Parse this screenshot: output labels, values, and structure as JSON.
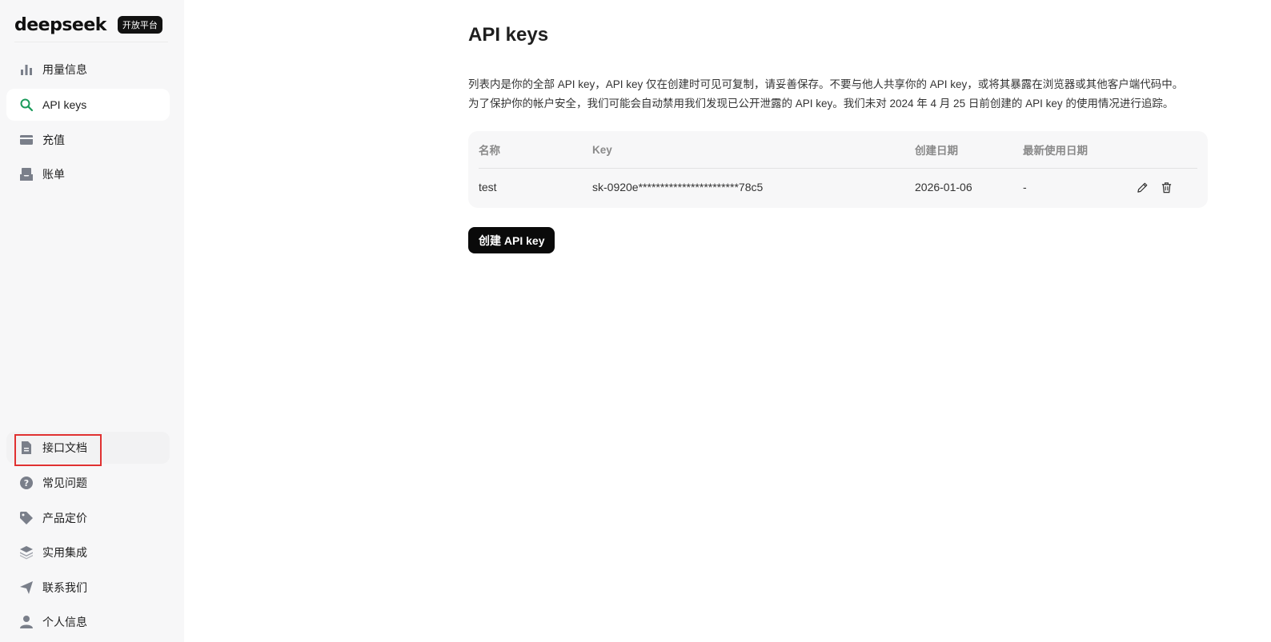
{
  "brand": {
    "logo": "deepseek",
    "badge": "开放平台"
  },
  "sidebar": {
    "top_items": [
      {
        "label": "用量信息",
        "icon": "bar-chart-icon"
      },
      {
        "label": "API keys",
        "icon": "search-icon",
        "active": true
      },
      {
        "label": "充值",
        "icon": "card-icon"
      },
      {
        "label": "账单",
        "icon": "inbox-icon"
      }
    ],
    "bottom_items": [
      {
        "label": "接口文档",
        "icon": "document-icon"
      },
      {
        "label": "常见问题",
        "icon": "question-icon"
      },
      {
        "label": "产品定价",
        "icon": "tag-icon"
      },
      {
        "label": "实用集成",
        "icon": "layers-icon"
      },
      {
        "label": "联系我们",
        "icon": "send-icon"
      },
      {
        "label": "个人信息",
        "icon": "user-icon"
      }
    ]
  },
  "main": {
    "title": "API keys",
    "description_lines": [
      "列表内是你的全部 API key，API key 仅在创建时可见可复制，请妥善保存。不要与他人共享你的 API key，或将其暴露在浏览器或其他客户端代码中。",
      "为了保护你的帐户安全，我们可能会自动禁用我们发现已公开泄露的 API key。我们未对 2024 年 4 月 25 日前创建的 API key 的使用情况进行追踪。"
    ],
    "table": {
      "columns": [
        "名称",
        "Key",
        "创建日期",
        "最新使用日期"
      ],
      "rows": [
        {
          "name": "test",
          "key": "sk-0920e***********************78c5",
          "created": "2026-01-06",
          "last_used": "-"
        }
      ]
    },
    "create_button": "创建 API key"
  },
  "colors": {
    "accent": "#1a9a5a",
    "sidebar_bg": "#f7f7f8",
    "highlight": "#e03131",
    "button_bg": "#0a0a0a"
  }
}
